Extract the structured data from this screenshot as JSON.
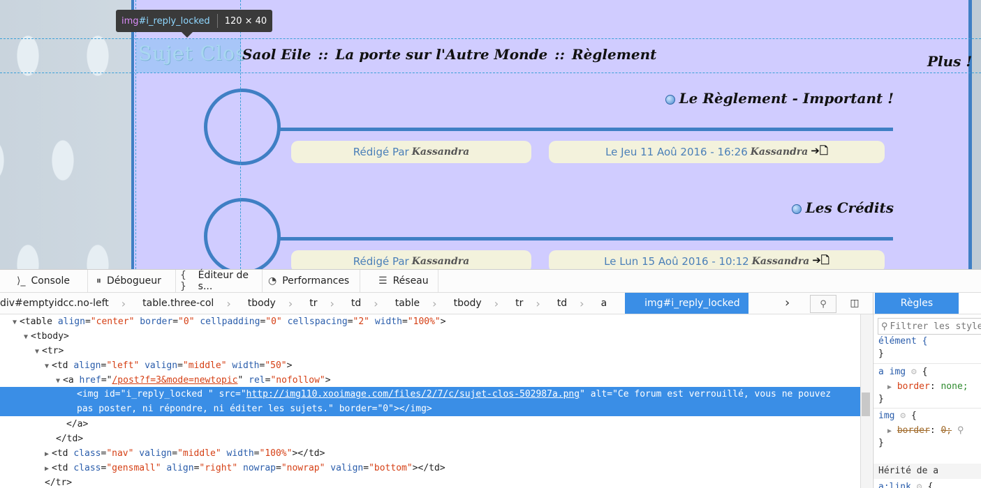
{
  "page": {
    "sujet_clos": "Sujet Clos",
    "breadcrumb": [
      "Saol Eile",
      "La porte sur l'Autre Monde",
      "Règlement"
    ],
    "breadcrumb_sep": "::",
    "plus": "Plus !",
    "topics": [
      {
        "title": "Le Règlement - Important !",
        "author_prefix": "Rédigé Par",
        "author": "Kassandra",
        "date": "Le Jeu 11 Aoû 2016 - 16:26",
        "last_user": "Kassandra",
        "go_icon": "➔🗋"
      },
      {
        "title": "Les Crédits",
        "author_prefix": "Rédigé Par",
        "author": "Kassandra",
        "date": "Le Lun 15 Aoû 2016 - 10:12",
        "last_user": "Kassandra",
        "go_icon": "➔🗋"
      }
    ]
  },
  "tooltip": {
    "tag": "img",
    "id": "#i_reply_locked",
    "size": "120 × 40"
  },
  "devtools": {
    "tabs": [
      {
        "icon": "⟩_",
        "label": "Console"
      },
      {
        "icon": "⏸",
        "label": "Débogueur"
      },
      {
        "icon": "{ }",
        "label": "Éditeur de s..."
      },
      {
        "icon": "◔",
        "label": "Performances"
      },
      {
        "icon": "☰",
        "label": "Réseau"
      }
    ],
    "crumbs": [
      "div#emptyidcc.no-left",
      "table.three-col",
      "tbody",
      "tr",
      "td",
      "table",
      "tbody",
      "tr",
      "td",
      "a",
      "img#i_reply_locked"
    ],
    "markup": {
      "l1": {
        "tag": "<table",
        "a1": "align",
        "v1": "\"center\"",
        "a2": "border",
        "v2": "\"0\"",
        "a3": "cellpadding",
        "v3": "\"0\"",
        "a4": "cellspacing",
        "v4": "\"2\"",
        "a5": "width",
        "v5": "\"100%\"",
        "end": ">"
      },
      "l2": "<tbody>",
      "l3": "<tr>",
      "l4": {
        "tag": "<td",
        "a1": "align",
        "v1": "\"left\"",
        "a2": "valign",
        "v2": "\"middle\"",
        "a3": "width",
        "v3": "\"50\"",
        "end": ">"
      },
      "l5": {
        "tag": "<a",
        "a1": "href",
        "v1": "/post?f=3&mode=newtopic",
        "a2": "rel",
        "v2": "\"nofollow\"",
        "end": ">"
      },
      "l6": {
        "tag": "<img",
        "a1": "id",
        "v1": "\"i_reply_locked \"",
        "a2": "src",
        "v2": "http://img110.xooimage.com/files/2/7/c/sujet-clos-502987a.png",
        "a3": "alt",
        "v3": "\"Ce forum est verrouillé, vous ne pouvez",
        "v3b": "pas poster, ni répondre, ni éditer les sujets.\"",
        "a4": "border",
        "v4": "\"0\"",
        "end": "></img>"
      },
      "l7": "</a>",
      "l8": "</td>",
      "l9": {
        "tag": "<td",
        "a1": "class",
        "v1": "\"nav\"",
        "a2": "valign",
        "v2": "\"middle\"",
        "a3": "width",
        "v3": "\"100%\"",
        "end": "></td>"
      },
      "l10": {
        "tag": "<td",
        "a1": "class",
        "v1": "\"gensmall\"",
        "a2": "align",
        "v2": "\"right\"",
        "a3": "nowrap",
        "v3": "\"nowrap\"",
        "a4": "valign",
        "v4": "\"bottom\"",
        "end": "></td>"
      },
      "l11": "</tr>"
    },
    "rules": {
      "tab": "Règles",
      "filter_placeholder": "Filtrer les styles",
      "element": "élément {",
      "close": "}",
      "r1_sel": "a img",
      "r1_prop": "border",
      "r1_val": "none;",
      "r2_sel": "img",
      "r2_prop": "border",
      "r2_val": "0;",
      "inherited": "Hérité de a",
      "r3_sel": "a:link"
    }
  }
}
